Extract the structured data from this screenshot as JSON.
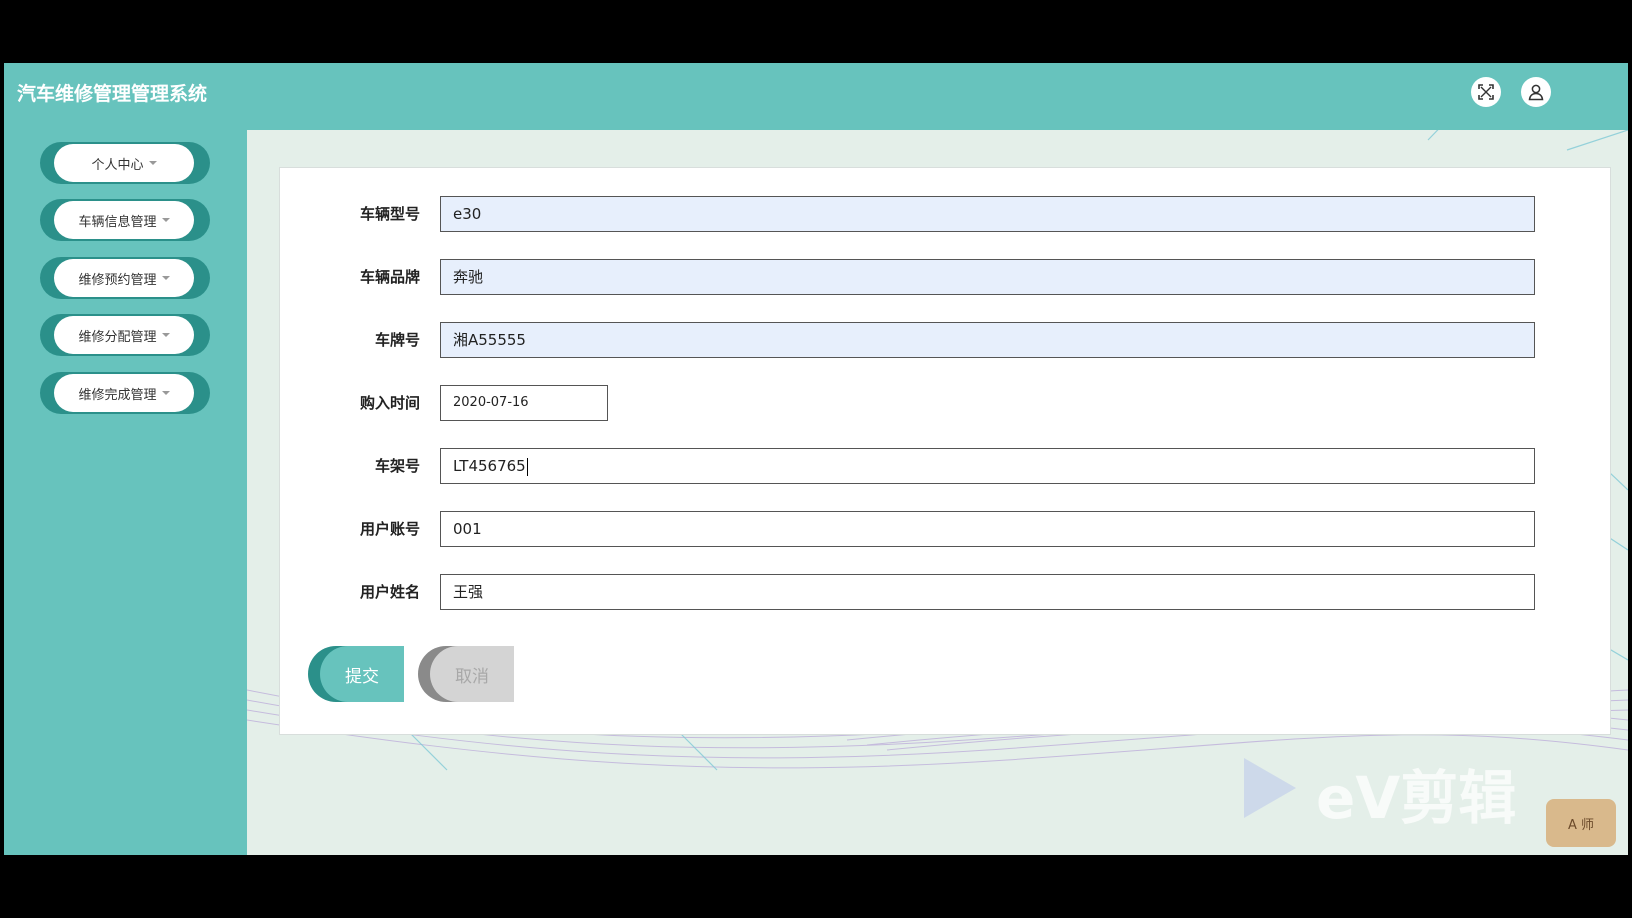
{
  "header": {
    "title": "汽车维修管理管理系统",
    "fullscreen_icon": "fullscreen-icon",
    "user_icon": "user-icon",
    "accent_color": "#67c3bd"
  },
  "sidebar": {
    "items": [
      {
        "label": "个人中心"
      },
      {
        "label": "车辆信息管理"
      },
      {
        "label": "维修预约管理"
      },
      {
        "label": "维修分配管理"
      },
      {
        "label": "维修完成管理"
      }
    ]
  },
  "form": {
    "fields": [
      {
        "label": "车辆型号",
        "value": "e30"
      },
      {
        "label": "车辆品牌",
        "value": "奔驰"
      },
      {
        "label": "车牌号",
        "value": "湘A55555"
      },
      {
        "label": "购入时间",
        "value": "2020-07-16"
      },
      {
        "label": "车架号",
        "value": "LT456765"
      },
      {
        "label": "用户账号",
        "value": "001"
      },
      {
        "label": "用户姓名",
        "value": "王强"
      }
    ],
    "submit_label": "提交",
    "cancel_label": "取消"
  },
  "watermark": {
    "text": "eV剪辑",
    "badge": "A 师"
  }
}
